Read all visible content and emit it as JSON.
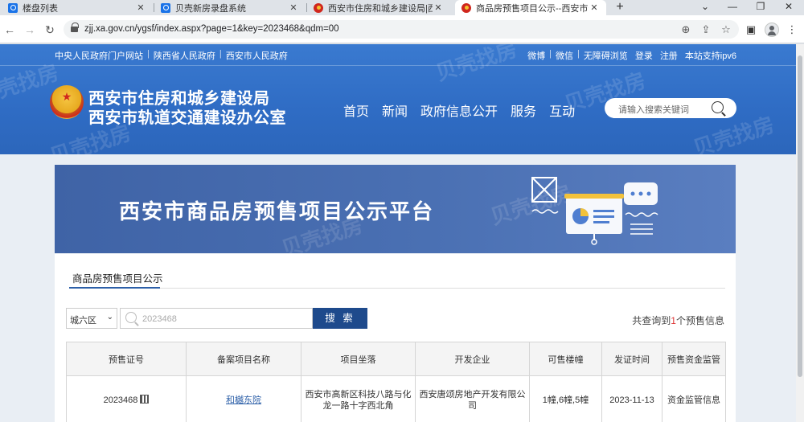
{
  "browser": {
    "tabs": [
      {
        "label": "楼盘列表",
        "icon": "blue-app-icon",
        "active": false
      },
      {
        "label": "贝壳新房录盘系统",
        "icon": "blue-app-icon",
        "active": false
      },
      {
        "label": "西安市住房和城乡建设局|西安市",
        "icon": "emblem-icon",
        "active": false
      },
      {
        "label": "商品房预售项目公示--西安市住",
        "icon": "emblem-icon",
        "active": true
      }
    ],
    "url": "zjj.xa.gov.cn/ygsf/index.aspx?page=1&key=2023468&qdm=00"
  },
  "site": {
    "top_links_left": [
      "中央人民政府门户网站",
      "陕西省人民政府",
      "西安市人民政府"
    ],
    "top_links_right": [
      "微博",
      "微信",
      "无障碍浏览",
      "登录",
      "注册",
      "本站支持ipv6"
    ],
    "org_name_1": "西安市住房和城乡建设局",
    "org_name_2": "西安市轨道交通建设办公室",
    "main_nav": [
      "首页",
      "新闻",
      "政府信息公开",
      "服务",
      "互动"
    ],
    "search_placeholder": "请输入搜索关键词",
    "watermark": "贝壳找房"
  },
  "banner": {
    "title": "西安市商品房预售项目公示平台"
  },
  "section": {
    "tab_label": "商品房预售项目公示",
    "district_value": "城六区",
    "keyword_value": "2023468",
    "search_button": "搜 索",
    "result_prefix": "共查询到",
    "result_count": "1",
    "result_suffix": "个预售信息"
  },
  "table": {
    "headers": [
      "预售证号",
      "备案项目名称",
      "项目坐落",
      "开发企业",
      "可售楼幢",
      "发证时间",
      "预售资金监管"
    ],
    "rows": [
      {
        "cert_no": "2023468",
        "project_name": "和樾东院",
        "location": "西安市高新区科技八路与化龙一路十字西北角",
        "developer": "西安唐颂房地产开发有限公司",
        "buildings": "1幢,6幢,5幢",
        "issue_date": "2023-11-13",
        "fund_supervision": "资金监管信息"
      }
    ]
  }
}
